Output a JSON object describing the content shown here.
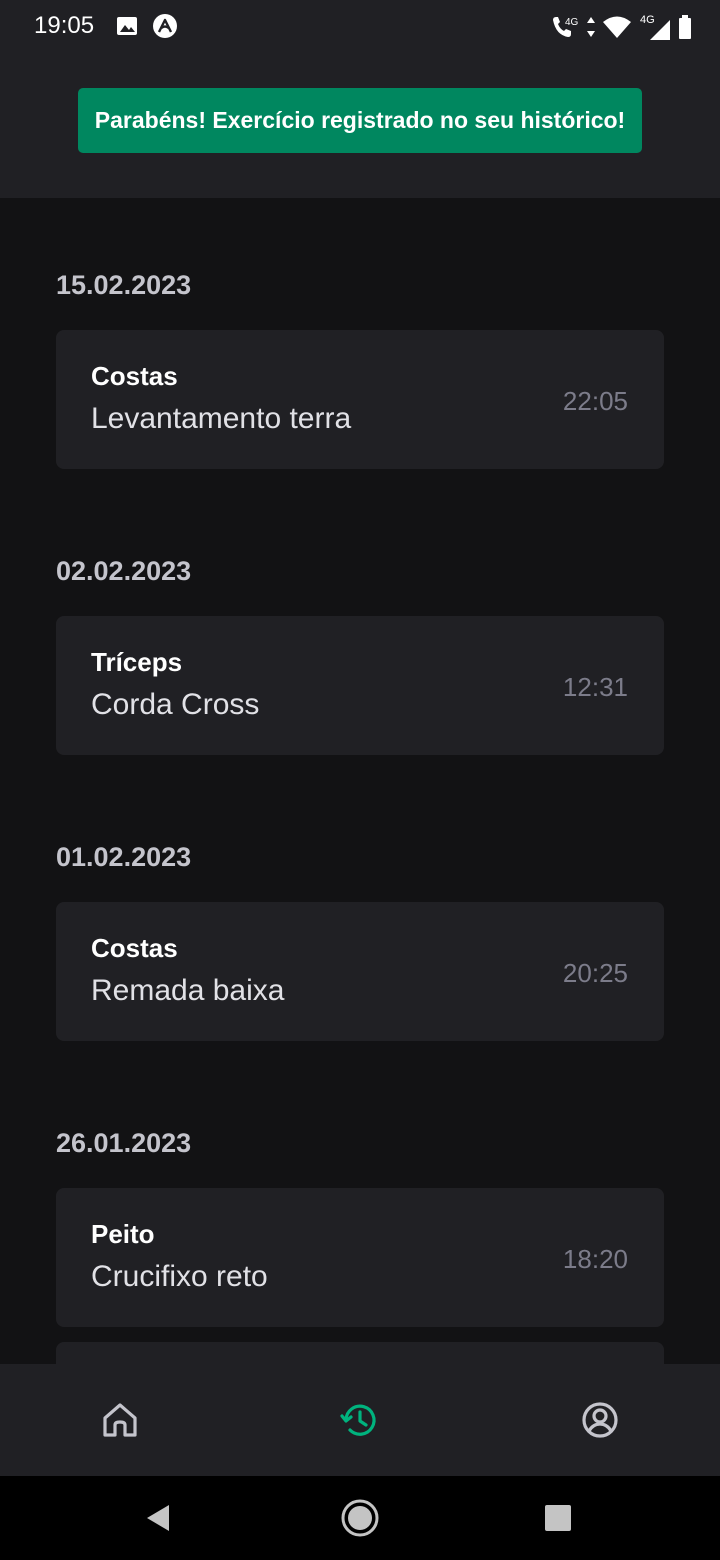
{
  "status_bar": {
    "time": "19:05",
    "net_call": "4G",
    "net_label": "4G",
    "icons": [
      "gallery-icon",
      "app-icon",
      "volte-call-icon",
      "data-arrows-icon",
      "wifi-icon",
      "signal-icon",
      "battery-icon"
    ]
  },
  "toast": {
    "message": "Parabéns! Exercício registrado no seu histórico!"
  },
  "history": [
    {
      "date": "15.02.2023",
      "group": "Costas",
      "name": "Levantamento terra",
      "time": "22:05"
    },
    {
      "date": "02.02.2023",
      "group": "Tríceps",
      "name": "Corda Cross",
      "time": "12:31"
    },
    {
      "date": "01.02.2023",
      "group": "Costas",
      "name": "Remada baixa",
      "time": "20:25"
    },
    {
      "date": "26.01.2023",
      "group": "Peito",
      "name": "Crucifixo reto",
      "time": "18:20"
    }
  ],
  "tab_bar": {
    "tabs": [
      {
        "icon": "home-icon",
        "active": false
      },
      {
        "icon": "history-icon",
        "active": true
      },
      {
        "icon": "profile-icon",
        "active": false
      }
    ]
  },
  "nav_bar": {
    "buttons": [
      "back-icon",
      "home-circle-icon",
      "recents-icon"
    ]
  },
  "colors": {
    "background": "#121214",
    "surface": "#202024",
    "accent": "#00875f",
    "active_tab": "#00b37e",
    "inactive_tab": "#c4c4cc",
    "muted_text": "#7c7c8a"
  }
}
